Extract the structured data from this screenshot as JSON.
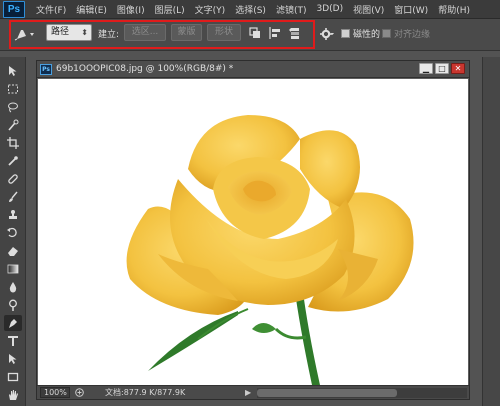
{
  "app": {
    "logo": "Ps"
  },
  "menu": [
    "文件(F)",
    "编辑(E)",
    "图像(I)",
    "图层(L)",
    "文字(Y)",
    "选择(S)",
    "滤镜(T)",
    "3D(D)",
    "视图(V)",
    "窗口(W)",
    "帮助(H)"
  ],
  "options": {
    "mode_value": "路径",
    "make_label": "建立:",
    "selection_btn": "选区...",
    "mask_btn": "蒙版",
    "shape_btn": "形状",
    "magnetic_label": "磁性的",
    "align_edges_label": "对齐边缘",
    "magnetic_checked": false,
    "align_edges_checked": false
  },
  "toolbar": {
    "tools": [
      "move-tool",
      "marquee-tool",
      "lasso-tool",
      "quick-select-tool",
      "crop-tool",
      "eyedropper-tool",
      "healing-brush-tool",
      "brush-tool",
      "clone-stamp-tool",
      "history-brush-tool",
      "eraser-tool",
      "gradient-tool",
      "blur-tool",
      "dodge-tool",
      "pen-tool",
      "type-tool",
      "path-select-tool",
      "shape-tool",
      "hand-tool",
      "zoom-tool"
    ],
    "active_tool": "pen-tool"
  },
  "document": {
    "title": "69b1OOOPIC08.jpg @ 100%(RGB/8#) *",
    "zoom": "100%",
    "doc_info": "文档:877.9 K/877.9K"
  },
  "colors": {
    "highlight": "#e01b1b",
    "rose_petal": "#f3c240",
    "rose_shadow": "#d99a1c",
    "stem": "#2f7a2a"
  }
}
